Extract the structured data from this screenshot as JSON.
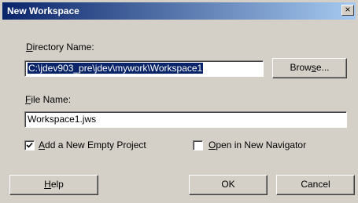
{
  "window": {
    "title": "New Workspace",
    "close_glyph": "×",
    "close_icon": "close-icon"
  },
  "directory": {
    "label_accel": "D",
    "label_rest": "irectory Name:",
    "value": "C:\\jdev903_pre\\jdev\\mywork\\Workspace1",
    "browse_pre": "Brow",
    "browse_accel": "s",
    "browse_post": "e..."
  },
  "file": {
    "label_accel": "F",
    "label_rest": "ile Name:",
    "value": "Workspace1.jws"
  },
  "options": {
    "add_project": {
      "accel": "A",
      "rest": "dd a New Empty Project",
      "checked": true
    },
    "open_navigator": {
      "accel": "O",
      "rest": "pen in New Navigator",
      "checked": false
    }
  },
  "buttons": {
    "help_accel": "H",
    "help_rest": "elp",
    "ok": "OK",
    "cancel": "Cancel"
  }
}
